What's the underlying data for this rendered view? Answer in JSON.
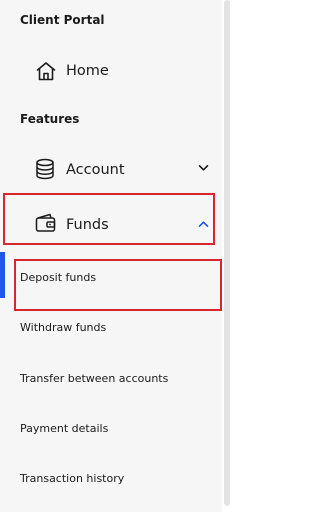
{
  "sidebar": {
    "portal_title": "Client Portal",
    "home_label": "Home",
    "features_title": "Features",
    "account_label": "Account",
    "funds_label": "Funds",
    "funds_items": [
      {
        "label": "Deposit funds",
        "active": true
      },
      {
        "label": "Withdraw funds",
        "active": false
      },
      {
        "label": "Transfer between accounts",
        "active": false
      },
      {
        "label": "Payment details",
        "active": false
      },
      {
        "label": "Transaction history",
        "active": false
      }
    ]
  },
  "icons": {
    "home": "home-icon",
    "account": "database-icon",
    "funds": "wallet-icon",
    "account_chevron": "chevron-down-icon",
    "funds_chevron": "chevron-up-icon"
  },
  "colors": {
    "sidebar_bg": "#f6f6f6",
    "active_indicator": "#1f57e8",
    "highlight_outline": "#d7262f",
    "funds_chevron": "#1f57e8",
    "text": "#1b1b1b"
  }
}
